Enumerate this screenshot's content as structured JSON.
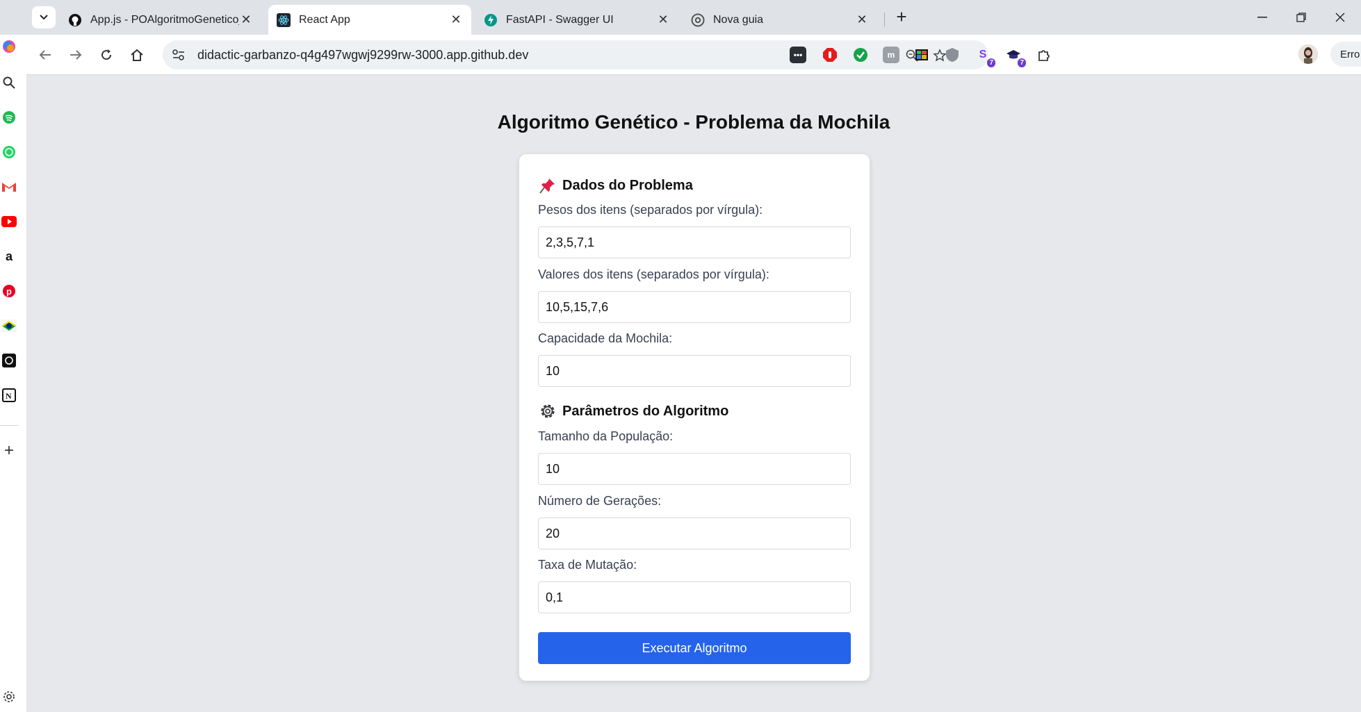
{
  "browser": {
    "tabs": [
      {
        "title": "App.js - POAlgoritmoGenetico_",
        "favicon": "github-icon",
        "active": false
      },
      {
        "title": "React App",
        "favicon": "react-icon",
        "active": true
      },
      {
        "title": "FastAPI - Swagger UI",
        "favicon": "fastapi-icon",
        "active": false
      },
      {
        "title": "Nova guia",
        "favicon": "chrome-icon",
        "active": false
      }
    ],
    "url": "didactic-garbanzo-q4g497wgwj9299rw-3000.app.github.dev",
    "extension_badges": [
      "7",
      "7"
    ],
    "profile_label": "Erro"
  },
  "sidebar": {
    "items": [
      "copilot",
      "search",
      "spotify",
      "whatsapp",
      "gmail",
      "youtube",
      "amazon",
      "pinterest",
      "brazil",
      "openai",
      "notion",
      "add",
      "settings"
    ]
  },
  "page": {
    "title": "Algoritmo Genético - Problema da Mochila"
  },
  "problem": {
    "heading": "Dados do Problema",
    "weights_label": "Pesos dos itens (separados por vírgula):",
    "weights_value": "2,3,5,7,1",
    "values_label": "Valores dos itens (separados por vírgula):",
    "values_value": "10,5,15,7,6",
    "capacity_label": "Capacidade da Mochila:",
    "capacity_value": "10"
  },
  "algorithm": {
    "heading": "Parâmetros do Algoritmo",
    "population_label": "Tamanho da População:",
    "population_value": "10",
    "generations_label": "Número de Gerações:",
    "generations_value": "20",
    "mutation_label": "Taxa de Mutação:",
    "mutation_value": "0,1"
  },
  "actions": {
    "run_label": "Executar Algoritmo"
  },
  "colors": {
    "primary": "#2563eb",
    "page_bg": "#e6e8ec",
    "card_bg": "#ffffff"
  }
}
